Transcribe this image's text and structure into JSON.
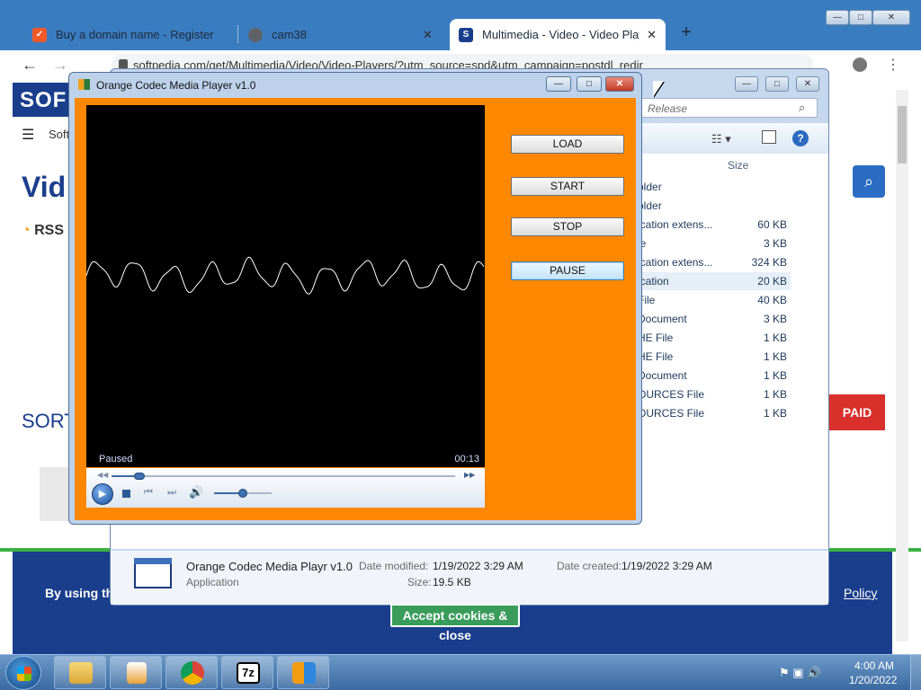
{
  "browser": {
    "tabs": [
      {
        "title": "Buy a domain name - Register ch",
        "favicon_color": "#f05a28"
      },
      {
        "title": "cam38",
        "favicon_color": "#5f6368"
      },
      {
        "title": "Multimedia - Video - Video Playe",
        "favicon_color": "#1a3e8c"
      }
    ],
    "url": "softpedia.com/get/Multimedia/Video/Video-Players/?utm_source=spd&utm_campaign=postdl_redir",
    "window_controls": {
      "minimize": "—",
      "maximize": "□",
      "close": "✕"
    },
    "new_tab": "+"
  },
  "softpedia": {
    "logo": "SOF",
    "menu_text": "Soft",
    "title": "Vid",
    "rss": "RSS",
    "sort": "SORT",
    "paid": "PAID",
    "cookie_text": "By using the s",
    "cookie_policy": "Policy",
    "cookie_button": "Accept cookies & close"
  },
  "explorer": {
    "search_placeholder": "Release",
    "column_size": "Size",
    "rows": [
      {
        "type": "older",
        "size": ""
      },
      {
        "type": "older",
        "size": ""
      },
      {
        "type": "ication extens...",
        "size": "60 KB"
      },
      {
        "type": "le",
        "size": "3 KB"
      },
      {
        "type": "ication extens...",
        "size": "324 KB"
      },
      {
        "type": "ication",
        "size": "20 KB",
        "selected": true
      },
      {
        "type": "File",
        "size": "40 KB"
      },
      {
        "type": "Document",
        "size": "3 KB"
      },
      {
        "type": "HE File",
        "size": "1 KB"
      },
      {
        "type": "HE File",
        "size": "1 KB"
      },
      {
        "type": "Document",
        "size": "1 KB"
      },
      {
        "type": "OURCES File",
        "size": "1 KB"
      },
      {
        "type": "OURCES File",
        "size": "1 KB"
      }
    ],
    "details": {
      "name": "Orange Codec Media Playr v1.0",
      "type": "Application",
      "date_modified_label": "Date modified:",
      "date_modified": "1/19/2022 3:29 AM",
      "date_created_label": "Date created:",
      "date_created": "1/19/2022 3:29 AM",
      "size_label": "Size:",
      "size": "19.5 KB"
    }
  },
  "player": {
    "title": "Orange Codec Media Player v1.0",
    "status": "Paused",
    "time": "00:13",
    "seek_progress": 0.08,
    "volume": 0.5,
    "buttons": {
      "load": "LOAD",
      "start": "START",
      "stop": "STOP",
      "pause": "PAUSE"
    },
    "focused_button": "pause"
  },
  "taskbar": {
    "time": "4:00 AM",
    "date": "1/20/2022",
    "tray": "⚑ ▣ 🔊"
  }
}
